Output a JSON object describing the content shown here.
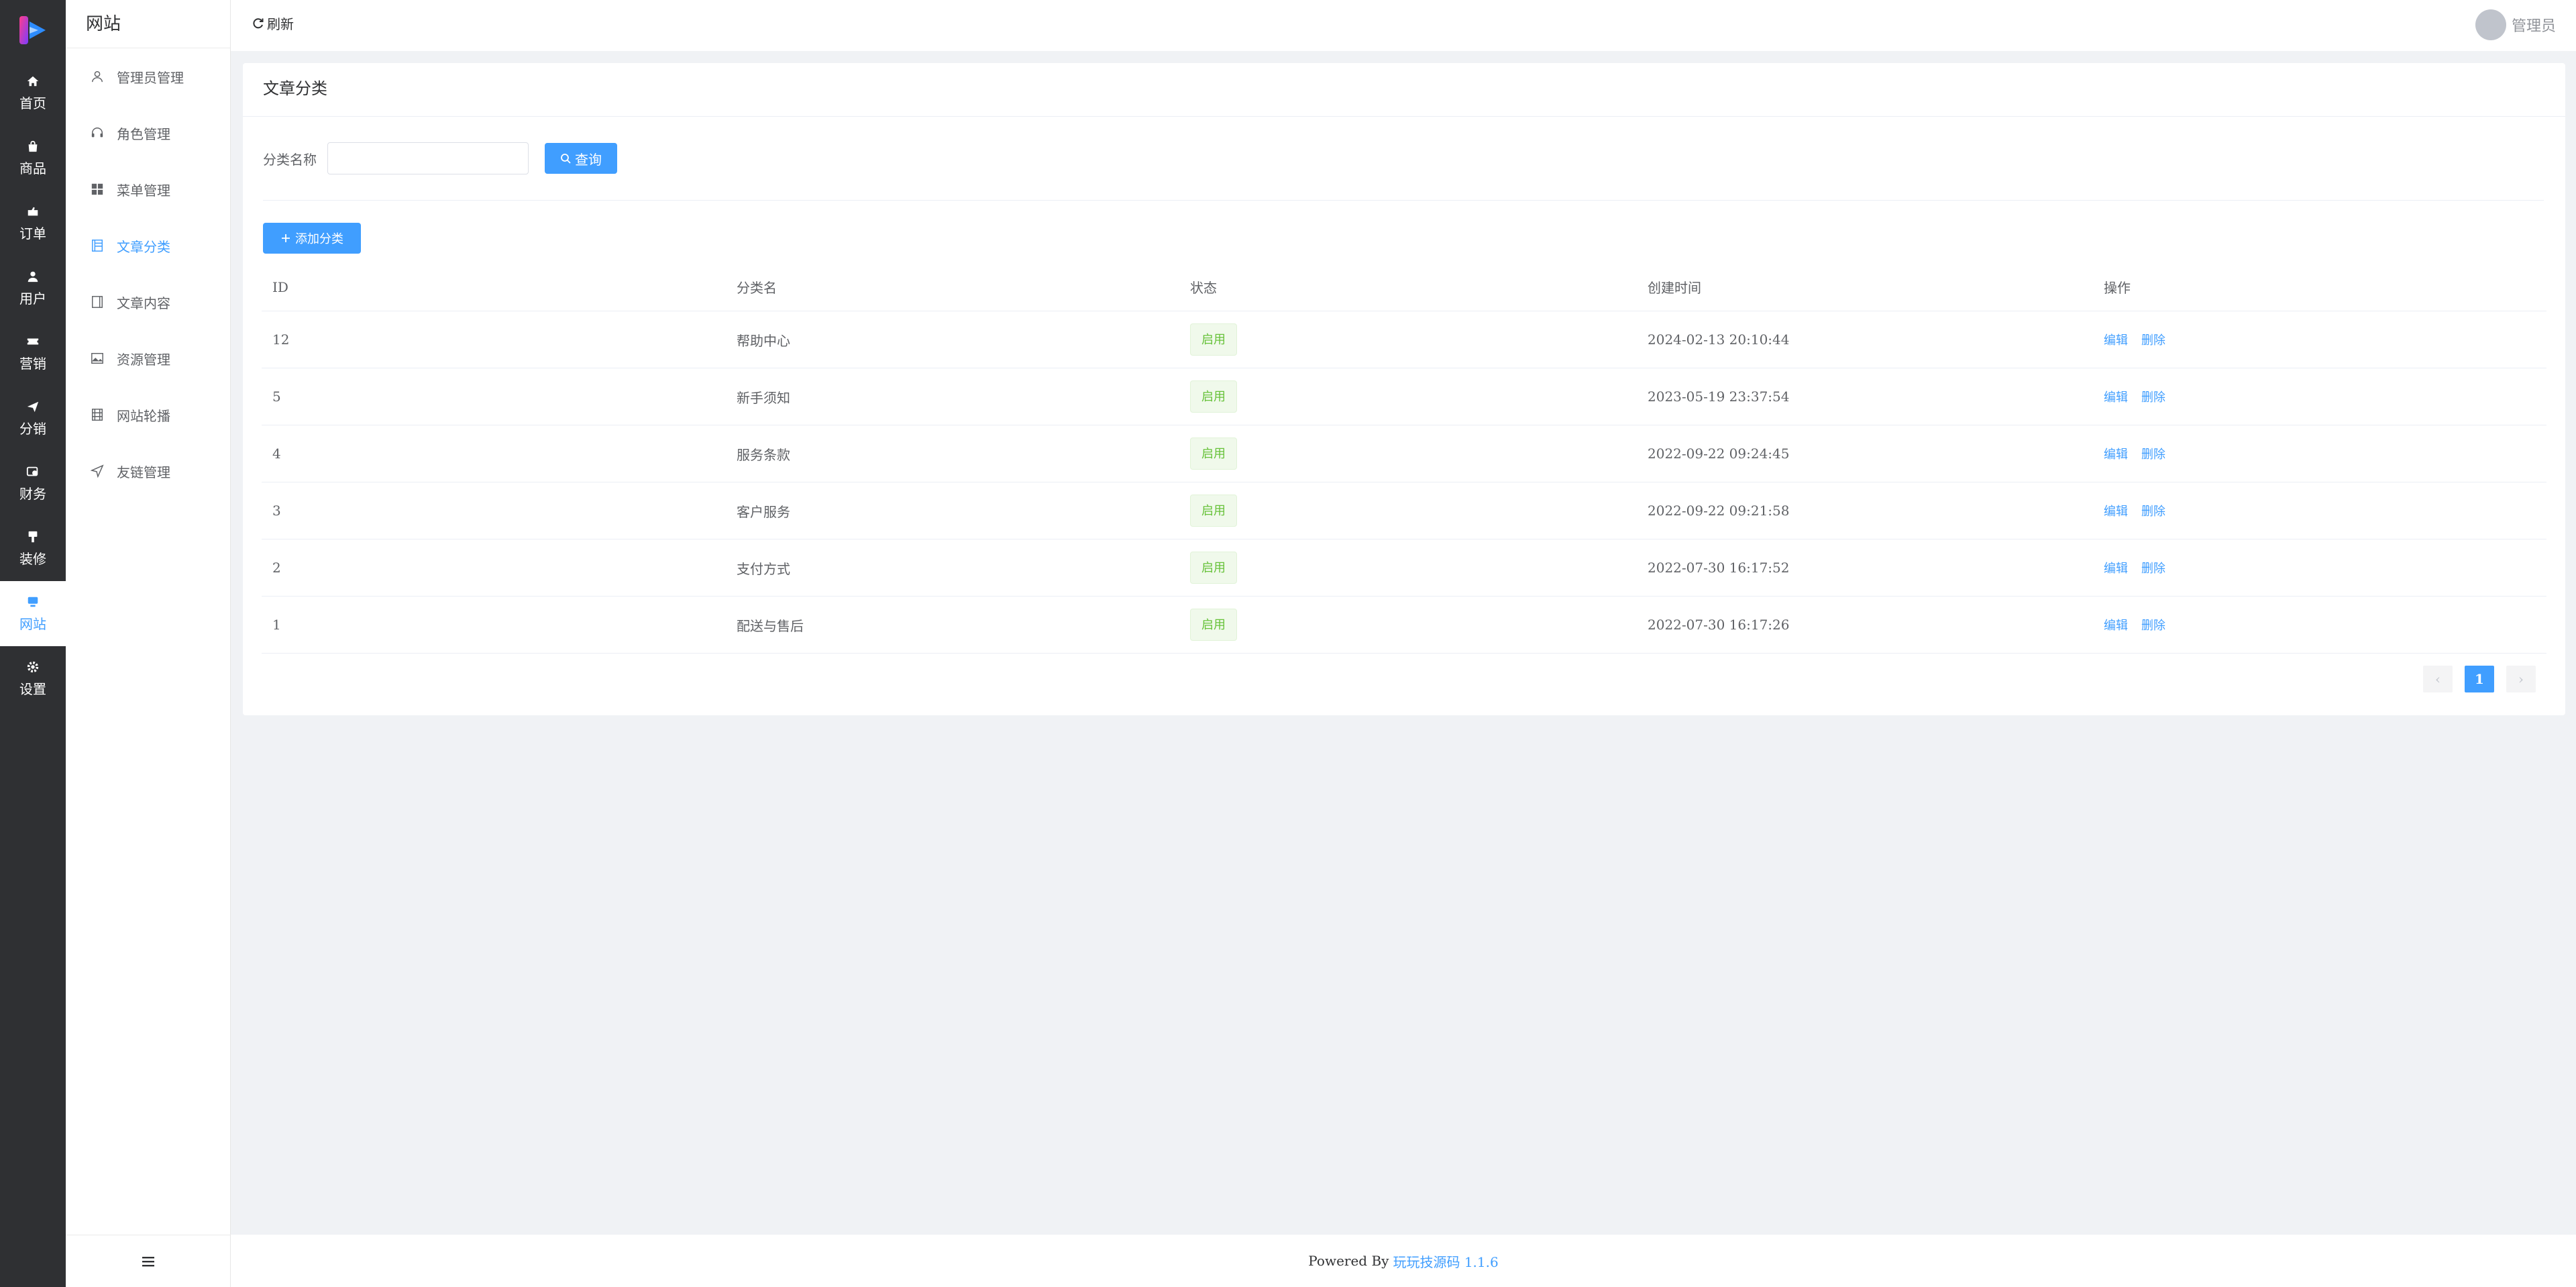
{
  "rail": {
    "items": [
      {
        "label": "首页",
        "icon": "home-icon"
      },
      {
        "label": "商品",
        "icon": "bag-icon"
      },
      {
        "label": "订单",
        "icon": "order-icon"
      },
      {
        "label": "用户",
        "icon": "user-icon"
      },
      {
        "label": "营销",
        "icon": "ticket-icon"
      },
      {
        "label": "分销",
        "icon": "send-icon"
      },
      {
        "label": "财务",
        "icon": "finance-icon"
      },
      {
        "label": "装修",
        "icon": "brush-icon"
      },
      {
        "label": "网站",
        "icon": "monitor-icon"
      },
      {
        "label": "设置",
        "icon": "gear-icon"
      }
    ],
    "active_index": 8
  },
  "sidebar": {
    "title": "网站",
    "items": [
      {
        "label": "管理员管理",
        "icon": "admin-icon"
      },
      {
        "label": "角色管理",
        "icon": "headset-icon"
      },
      {
        "label": "菜单管理",
        "icon": "grid-icon"
      },
      {
        "label": "文章分类",
        "icon": "document-icon"
      },
      {
        "label": "文章内容",
        "icon": "notebook-icon"
      },
      {
        "label": "资源管理",
        "icon": "picture-icon"
      },
      {
        "label": "网站轮播",
        "icon": "film-icon"
      },
      {
        "label": "友链管理",
        "icon": "position-icon"
      }
    ],
    "active_index": 3
  },
  "topbar": {
    "refresh_label": "刷新",
    "user_name": "管理员"
  },
  "card": {
    "title": "文章分类",
    "filter_label": "分类名称",
    "search_label": "查询",
    "add_label": "添加分类"
  },
  "table": {
    "headers": [
      "ID",
      "分类名",
      "状态",
      "创建时间",
      "操作"
    ],
    "rows": [
      {
        "id": "12",
        "name": "帮助中心",
        "status": "启用",
        "created": "2024-02-13 20:10:44",
        "edit": "编辑",
        "delete": "删除"
      },
      {
        "id": "5",
        "name": "新手须知",
        "status": "启用",
        "created": "2023-05-19 23:37:54",
        "edit": "编辑",
        "delete": "删除"
      },
      {
        "id": "4",
        "name": "服务条款",
        "status": "启用",
        "created": "2022-09-22 09:24:45",
        "edit": "编辑",
        "delete": "删除"
      },
      {
        "id": "3",
        "name": "客户服务",
        "status": "启用",
        "created": "2022-09-22 09:21:58",
        "edit": "编辑",
        "delete": "删除"
      },
      {
        "id": "2",
        "name": "支付方式",
        "status": "启用",
        "created": "2022-07-30 16:17:52",
        "edit": "编辑",
        "delete": "删除"
      },
      {
        "id": "1",
        "name": "配送与售后",
        "status": "启用",
        "created": "2022-07-30 16:17:26",
        "edit": "编辑",
        "delete": "删除"
      }
    ]
  },
  "pagination": {
    "current_page": "1",
    "prev": "‹",
    "next": "›"
  },
  "footer": {
    "prefix": "Powered By",
    "brand": "玩玩技源码 1.1.6"
  },
  "colors": {
    "accent": "#409eff",
    "rail_bg": "#2f3033",
    "success": "#67c23a"
  }
}
